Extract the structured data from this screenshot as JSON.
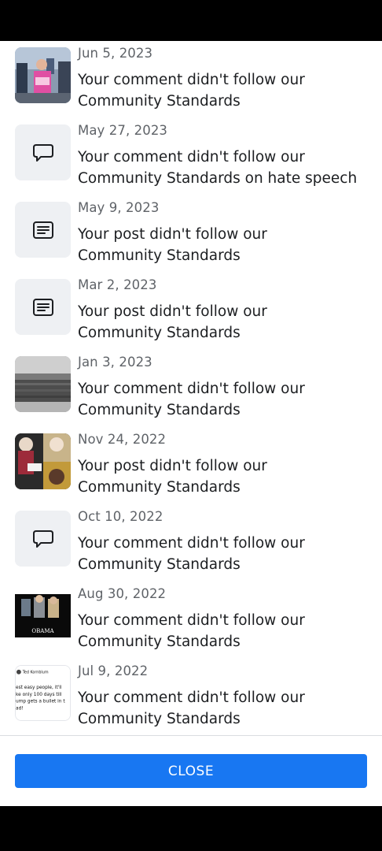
{
  "items": [
    {
      "date": "Jun 5, 2023",
      "line1": "Your comment didn't follow our",
      "line2": "Community Standards",
      "thumb": "photo-protest"
    },
    {
      "date": "May 27, 2023",
      "line1": "Your comment didn't follow our",
      "line2": "Community Standards on hate speech",
      "thumb": "comment-icon"
    },
    {
      "date": "May 9, 2023",
      "line1": "Your post didn't follow our",
      "line2": "Community Standards",
      "thumb": "post-icon"
    },
    {
      "date": "Mar 2, 2023",
      "line1": "Your post didn't follow our",
      "line2": "Community Standards",
      "thumb": "post-icon"
    },
    {
      "date": "Jan 3, 2023",
      "line1": "Your comment didn't follow our",
      "line2": "Community Standards",
      "thumb": "photo-crowd"
    },
    {
      "date": "Nov 24, 2022",
      "line1": "Your post didn't follow our",
      "line2": "Community Standards",
      "thumb": "photo-collage"
    },
    {
      "date": "Oct 10, 2022",
      "line1": "Your comment didn't follow our",
      "line2": "Community Standards",
      "thumb": "comment-icon"
    },
    {
      "date": "Aug 30, 2022",
      "line1": "Your comment didn't follow our",
      "line2": "Community Standards",
      "thumb": "photo-obama"
    },
    {
      "date": "Jul 9, 2022",
      "line1": "Your comment didn't follow our",
      "line2": "Community Standards",
      "thumb": "photo-tweet"
    }
  ],
  "thumb_text": {
    "obama_caption": "OBAMA",
    "tweet_author": "Ted Kornblum",
    "tweet_lines": [
      "est easy people, it'll",
      "ke only 100 days till",
      "ump gets a bullet in t",
      "ad!"
    ]
  },
  "footer": {
    "close_label": "CLOSE"
  },
  "colors": {
    "accent": "#1877f2",
    "text": "#1c1e21",
    "secondary": "#5f6368",
    "icon_bg": "#eef0f3"
  }
}
